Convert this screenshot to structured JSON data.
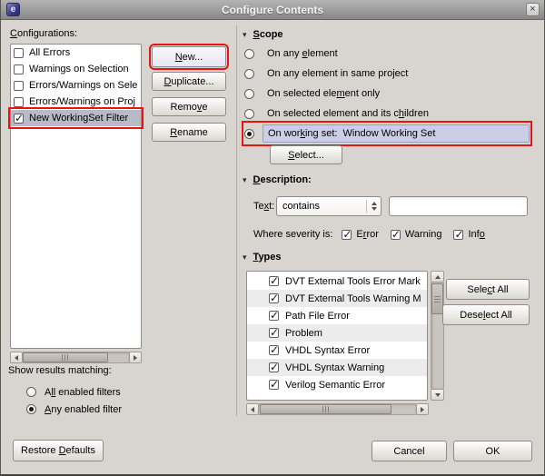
{
  "colors": {
    "annotation": "#e81410",
    "selection": "#b8bac8",
    "highlight": "#cbcee6",
    "titlebar_text": "#f4f4f4"
  },
  "window": {
    "title": "Configure Contents"
  },
  "icons": {
    "app_logo": "e",
    "close": "×",
    "expander": "▾",
    "checkmark": "✓"
  },
  "left": {
    "configurations_label": "_C_onfigurations:",
    "configurations": [
      {
        "label": "All Errors",
        "checked": false,
        "selected": false
      },
      {
        "label": "Warnings on Selection",
        "checked": false,
        "selected": false
      },
      {
        "label": "Errors/Warnings on Sele",
        "checked": false,
        "selected": false
      },
      {
        "label": "Errors/Warnings on Proj",
        "checked": false,
        "selected": false
      },
      {
        "label": "New WorkingSet Filter",
        "checked": true,
        "selected": true,
        "annotated": true
      }
    ],
    "show_results_label": "Show results matching:",
    "match_options": [
      {
        "label": "A_ll_ enabled filters",
        "selected": false
      },
      {
        "label": "_A_ny enabled filter",
        "selected": true
      }
    ]
  },
  "actions": {
    "new": "_N_ew...",
    "duplicate": "_D_uplicate...",
    "remove": "Remo_v_e",
    "rename": "_R_ename"
  },
  "scope": {
    "header": "_S_cope",
    "options": [
      {
        "label": "On any _e_lement",
        "selected": false
      },
      {
        "label": "On any element in same pro_j_ect",
        "selected": false
      },
      {
        "label": "On selected ele_m_ent only",
        "selected": false
      },
      {
        "label": "On selected element and its c_h_ildren",
        "selected": false
      },
      {
        "label": "On wor_k_ing set:  Window Working Set",
        "selected": true,
        "highlighted": true,
        "annotated": true
      }
    ],
    "select_button": "_S_elect..."
  },
  "description": {
    "header": "_D_escription:",
    "text_label": "Te_x_t:",
    "match_mode": "contains",
    "text_value": "",
    "severity_label": "Where severity is:",
    "severities": [
      {
        "label": "E_r_ror",
        "checked": true
      },
      {
        "label": "Warnin_g_",
        "checked": true
      },
      {
        "label": "Inf_o_",
        "checked": true
      }
    ]
  },
  "types": {
    "header": "_T_ypes",
    "items": [
      {
        "label": "DVT External Tools Error Mark",
        "checked": true
      },
      {
        "label": "DVT External Tools Warning M",
        "checked": true
      },
      {
        "label": "Path File Error",
        "checked": true
      },
      {
        "label": "Problem",
        "checked": true
      },
      {
        "label": "VHDL Syntax Error",
        "checked": true
      },
      {
        "label": "VHDL Syntax Warning",
        "checked": true
      },
      {
        "label": "Verilog Semantic Error",
        "checked": true
      }
    ],
    "select_all": "Sele_c_t All",
    "deselect_all": "Dese_l_ect All"
  },
  "footer": {
    "restore_defaults": "Restore _D_efaults",
    "cancel": "Cancel",
    "ok": "OK"
  }
}
